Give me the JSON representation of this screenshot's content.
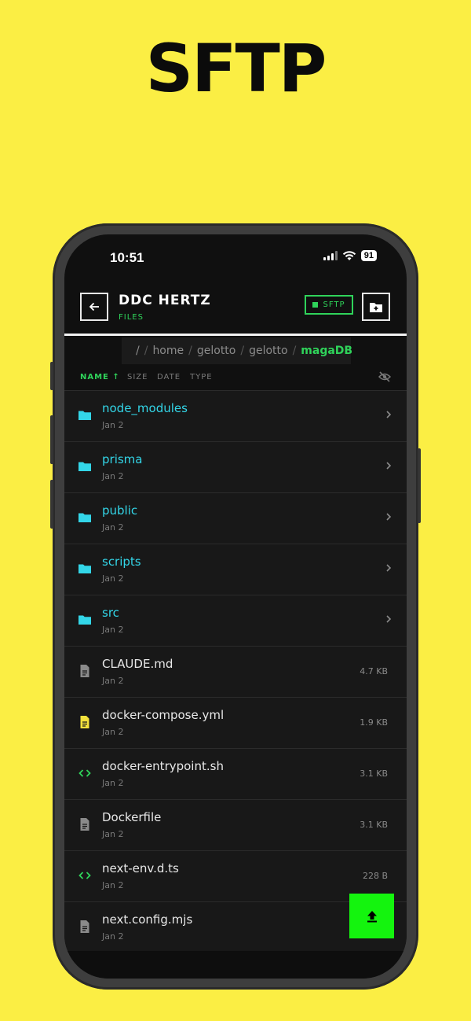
{
  "promo": {
    "title": "SFTP"
  },
  "status_bar": {
    "time": "10:51",
    "battery": "91"
  },
  "header": {
    "host": "DDC HERTZ",
    "subtitle": "FILES",
    "protocol_badge": "SFTP"
  },
  "breadcrumb": {
    "root": "/",
    "segments": [
      "home",
      "gelotto",
      "gelotto"
    ],
    "current": "magaDB"
  },
  "sort": {
    "name_label": "NAME ↑",
    "size_label": "SIZE",
    "date_label": "DATE",
    "type_label": "TYPE"
  },
  "files": [
    {
      "name": "node_modules",
      "date": "Jan 2",
      "size": "",
      "kind": "folder",
      "icon": "folder-icon"
    },
    {
      "name": "prisma",
      "date": "Jan 2",
      "size": "",
      "kind": "folder",
      "icon": "folder-icon"
    },
    {
      "name": "public",
      "date": "Jan 2",
      "size": "",
      "kind": "folder",
      "icon": "folder-icon"
    },
    {
      "name": "scripts",
      "date": "Jan 2",
      "size": "",
      "kind": "folder",
      "icon": "folder-icon"
    },
    {
      "name": "src",
      "date": "Jan 2",
      "size": "",
      "kind": "folder",
      "icon": "folder-icon"
    },
    {
      "name": "CLAUDE.md",
      "date": "Jan 2",
      "size": "4.7 KB",
      "kind": "file",
      "icon": "document-icon"
    },
    {
      "name": "docker-compose.yml",
      "date": "Jan 2",
      "size": "1.9 KB",
      "kind": "file",
      "icon": "yaml-document-icon"
    },
    {
      "name": "docker-entrypoint.sh",
      "date": "Jan 2",
      "size": "3.1 KB",
      "kind": "file",
      "icon": "code-icon"
    },
    {
      "name": "Dockerfile",
      "date": "Jan 2",
      "size": "3.1 KB",
      "kind": "file",
      "icon": "document-icon"
    },
    {
      "name": "next-env.d.ts",
      "date": "Jan 2",
      "size": "228 B",
      "kind": "file",
      "icon": "code-icon"
    },
    {
      "name": "next.config.mjs",
      "date": "Jan 2",
      "size": "",
      "kind": "file",
      "icon": "document-icon"
    }
  ],
  "colors": {
    "background": "#fbee44",
    "accent_green": "#2fd35a",
    "folder_cyan": "#33d6e8",
    "fab_green": "#14f40e",
    "yaml_yellow": "#f4e23c"
  }
}
